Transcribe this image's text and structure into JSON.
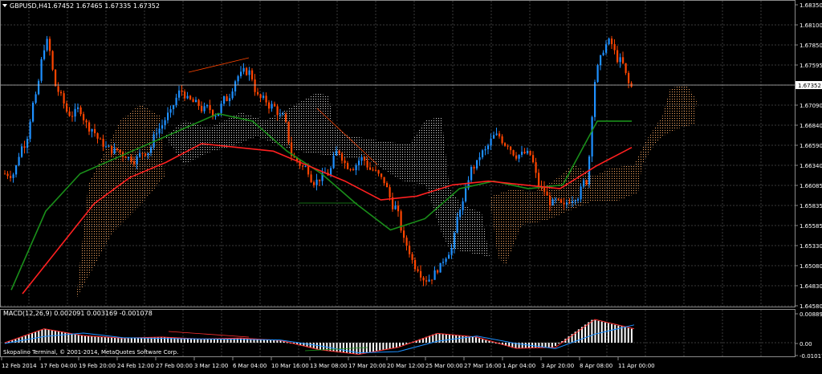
{
  "header": {
    "symbol_period": "GBPUSD,H4",
    "ohlc": "1.67452 1.67465 1.67335 1.67352"
  },
  "indicator": {
    "title": "MACD(12,26,9) 0.002091 0.003169 -0.001078"
  },
  "copyright": "Skopalino Terminal, © 2001-2014, MetaQuotes Software Corp.",
  "colors": {
    "background": "#000000",
    "grid": "#3a3a3a",
    "bull_candle": "#1e90ff",
    "bear_candle": "#ff4500",
    "ma_fast": "#1a8f1a",
    "ma_slow": "#ff2020",
    "cloud_bull": "#f4a460",
    "cloud_bear": "#d8d8d8",
    "macd_main": "#ff3030",
    "macd_signal": "#1e90ff",
    "price_line": "#c0c0c0"
  },
  "price_axis": {
    "labels": [
      "1.68350",
      "1.68100",
      "1.67850",
      "1.67595",
      "1.67352",
      "1.67090",
      "1.66840",
      "1.66590",
      "1.66340",
      "1.66085",
      "1.65835",
      "1.65585",
      "1.65330",
      "1.65080",
      "1.64830",
      "1.64580"
    ],
    "current_price": "1.67352"
  },
  "macd_axis": {
    "labels": [
      "0.00889",
      "0.00",
      "-0.01017"
    ]
  },
  "time_axis": {
    "labels": [
      "12 Feb 2014",
      "17 Feb 04:00",
      "19 Feb 20:00",
      "24 Feb 12:00",
      "27 Feb 00:00",
      "3 Mar 12:00",
      "6 Mar 04:00",
      "10 Mar 16:00",
      "13 Mar 08:00",
      "17 Mar 20:00",
      "20 Mar 12:00",
      "25 Mar 00:00",
      "27 Mar 16:00",
      "1 Apr 04:00",
      "3 Apr 20:00",
      "8 Apr 08:00",
      "11 Apr 00:00"
    ]
  },
  "chart_data": {
    "type": "candlestick",
    "symbol": "GBPUSD",
    "timeframe": "H4",
    "ylim": [
      1.6445,
      1.6845
    ],
    "series": [
      {
        "indicator": "close",
        "values": [
          1.662,
          1.666,
          1.672,
          1.6795,
          1.673,
          1.67,
          1.6705,
          1.668,
          1.666,
          1.665,
          1.6645,
          1.664,
          1.665,
          1.668,
          1.67,
          1.673,
          1.6715,
          1.6705,
          1.67,
          1.672,
          1.675,
          1.6755,
          1.672,
          1.671,
          1.6695,
          1.664,
          1.6628,
          1.661,
          1.662,
          1.665,
          1.663,
          1.664,
          1.6625,
          1.661,
          1.6575,
          1.6525,
          1.6495,
          1.648,
          1.6495,
          1.652,
          1.658,
          1.663,
          1.665,
          1.667,
          1.666,
          1.6645,
          1.6645,
          1.66,
          1.658,
          1.6575,
          1.659,
          1.661,
          1.676,
          1.6795,
          1.677,
          1.6735
        ]
      },
      {
        "indicator": "MA fast",
        "values": [
          1.6465,
          1.657,
          1.662,
          1.664,
          1.666,
          1.668,
          1.67,
          1.669,
          1.665,
          1.662,
          1.658,
          1.6545,
          1.656,
          1.66,
          1.661,
          1.66,
          1.6605,
          1.669,
          1.669
        ]
      },
      {
        "indicator": "MA slow",
        "values": [
          1.646,
          1.652,
          1.658,
          1.6615,
          1.6635,
          1.666,
          1.6655,
          1.665,
          1.663,
          1.661,
          1.6585,
          1.659,
          1.6605,
          1.661,
          1.6605,
          1.66,
          1.663,
          1.6655
        ]
      },
      {
        "indicator": "MACD",
        "values": [
          0.0,
          0.003,
          0.0015,
          0.001,
          0.0012,
          0.0008,
          0.001,
          0.0005,
          -0.0015,
          -0.0025,
          -0.001,
          0.002,
          0.0012,
          -0.0012,
          -0.001,
          0.005,
          0.003
        ]
      }
    ]
  }
}
